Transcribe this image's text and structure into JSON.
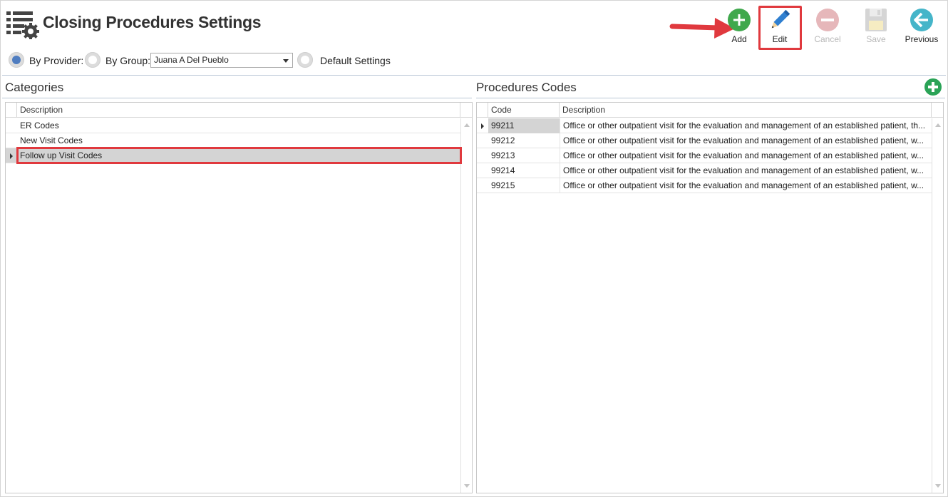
{
  "header": {
    "title": "Closing Procedures Settings",
    "app_icon": "list-settings-icon"
  },
  "toolbar": {
    "add_label": "Add",
    "edit_label": "Edit",
    "cancel_label": "Cancel",
    "save_label": "Save",
    "previous_label": "Previous",
    "add_color": "#3fa84c",
    "edit_color": "#2f7fd0",
    "previous_color": "#45b5c9",
    "disabled_color": "#e6b7ba"
  },
  "filter": {
    "by_provider_label": "By Provider:",
    "by_group_label": "By Group:",
    "group_value": "Juana A Del Pueblo",
    "default_settings_label": "Default Settings",
    "selected": "By Provider"
  },
  "categories": {
    "title": "Categories",
    "column_description": "Description",
    "rows": [
      {
        "description": "ER Codes"
      },
      {
        "description": "New Visit Codes"
      },
      {
        "description": "Follow up Visit Codes"
      }
    ],
    "selected_index": 2
  },
  "procedure_codes": {
    "title": "Procedures Codes",
    "column_code": "Code",
    "column_description": "Description",
    "rows": [
      {
        "code": "99211",
        "description": "Office or other outpatient visit for the evaluation and management of an established patient, th..."
      },
      {
        "code": "99212",
        "description": "Office or other outpatient visit for the evaluation and management of an established patient, w..."
      },
      {
        "code": "99213",
        "description": "Office or other outpatient visit for the evaluation and management of an established patient, w..."
      },
      {
        "code": "99214",
        "description": "Office or other outpatient visit for the evaluation and management of an established patient, w..."
      },
      {
        "code": "99215",
        "description": "Office or other outpatient visit for the evaluation and management of an established patient, w..."
      }
    ],
    "selected_index": 0
  },
  "colors": {
    "highlight_red": "#e0393e",
    "selected_row": "#d4d4d4",
    "radio_selected": "#4f7dc0"
  }
}
